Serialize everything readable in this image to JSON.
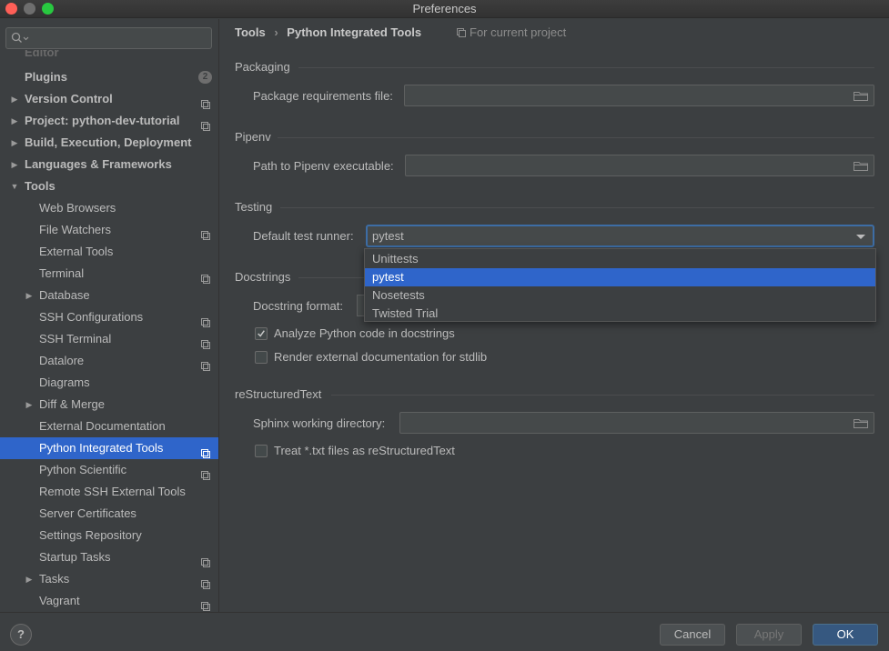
{
  "window": {
    "title": "Preferences"
  },
  "sidebar": {
    "search_placeholder": "",
    "cut_item": "Editor",
    "plugins_label": "Plugins",
    "plugins_badge": "2",
    "items": [
      {
        "label": "Version Control",
        "bold": true,
        "arrow": "right",
        "project": true
      },
      {
        "label": "Project: python-dev-tutorial",
        "bold": true,
        "arrow": "right",
        "project": true
      },
      {
        "label": "Build, Execution, Deployment",
        "bold": true,
        "arrow": "right",
        "project": false
      },
      {
        "label": "Languages & Frameworks",
        "bold": true,
        "arrow": "right",
        "project": false
      },
      {
        "label": "Tools",
        "bold": true,
        "arrow": "down",
        "project": false
      },
      {
        "label": "Web Browsers",
        "project": false
      },
      {
        "label": "File Watchers",
        "project": true
      },
      {
        "label": "External Tools",
        "project": false
      },
      {
        "label": "Terminal",
        "project": true
      },
      {
        "label": "Database",
        "arrow": "right",
        "project": false
      },
      {
        "label": "SSH Configurations",
        "project": true
      },
      {
        "label": "SSH Terminal",
        "project": true
      },
      {
        "label": "Datalore",
        "project": true
      },
      {
        "label": "Diagrams",
        "project": false
      },
      {
        "label": "Diff & Merge",
        "arrow": "right",
        "project": false
      },
      {
        "label": "External Documentation",
        "project": false
      },
      {
        "label": "Python Integrated Tools",
        "project": true,
        "selected": true
      },
      {
        "label": "Python Scientific",
        "project": true
      },
      {
        "label": "Remote SSH External Tools",
        "project": false
      },
      {
        "label": "Server Certificates",
        "project": false
      },
      {
        "label": "Settings Repository",
        "project": false
      },
      {
        "label": "Startup Tasks",
        "project": true
      },
      {
        "label": "Tasks",
        "arrow": "right",
        "project": true
      },
      {
        "label": "Vagrant",
        "project": true
      }
    ]
  },
  "breadcrumb": {
    "parent": "Tools",
    "separator": "›",
    "current": "Python Integrated Tools"
  },
  "scope_note": "For current project",
  "packaging": {
    "title": "Packaging",
    "req_label": "Package requirements file:",
    "req_value": ""
  },
  "pipenv": {
    "title": "Pipenv",
    "path_label": "Path to Pipenv executable:",
    "path_value": ""
  },
  "testing": {
    "title": "Testing",
    "runner_label": "Default test runner:",
    "runner_value": "pytest",
    "options": [
      "Unittests",
      "pytest",
      "Nosetests",
      "Twisted Trial"
    ],
    "selected_index": 1
  },
  "docstrings": {
    "title": "Docstrings",
    "format_label": "Docstring format:",
    "analyze_label": "Analyze Python code in docstrings",
    "analyze_checked": true,
    "render_label": "Render external documentation for stdlib",
    "render_checked": false
  },
  "rest": {
    "title": "reStructuredText",
    "sphinx_label": "Sphinx working directory:",
    "sphinx_value": "",
    "treat_label": "Treat *.txt files as reStructuredText",
    "treat_checked": false
  },
  "buttons": {
    "help": "?",
    "cancel": "Cancel",
    "apply": "Apply",
    "ok": "OK"
  },
  "colors": {
    "selection": "#2f65ca",
    "background": "#3c3f41",
    "primary_button": "#365880"
  }
}
